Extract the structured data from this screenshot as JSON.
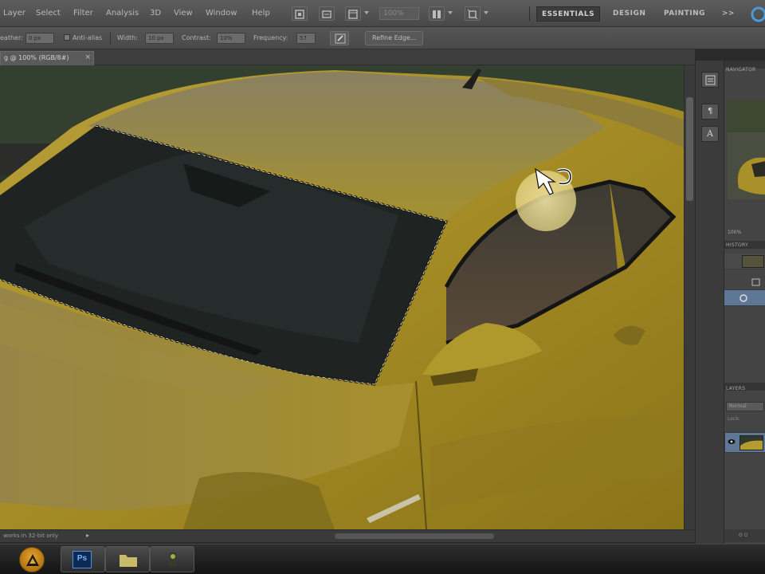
{
  "menu": {
    "items": [
      "Layer",
      "Select",
      "Filter",
      "Analysis",
      "3D",
      "View",
      "Window",
      "Help"
    ]
  },
  "app_bar": {
    "zoom": "100%",
    "workspaces": [
      "ESSENTIALS",
      "DESIGN",
      "PAINTING",
      ">>"
    ]
  },
  "options": {
    "feather_label": "eather:",
    "feather_value": "0 px",
    "anti_alias_label": "Anti-alias",
    "width_label": "Width:",
    "width_value": "10 px",
    "contrast_label": "Contrast:",
    "contrast_value": "10%",
    "frequency_label": "Frequency:",
    "frequency_value": "57",
    "refine_edge_label": "Refine Edge..."
  },
  "document": {
    "tab_title": "g @ 100% (RGB/8#)",
    "status_text": "works in 32-bit only"
  },
  "panels": {
    "navigator_title": "NAVIGATOR",
    "navigator_zoom": "100%",
    "history_title": "HISTORY",
    "layers_title": "LAYERS",
    "blend_mode": "Normal",
    "lock_label": "Lock:",
    "bottom_text": "Θ O"
  },
  "taskbar": {
    "ps_label": "Ps"
  },
  "colors": {
    "car_body": "#a8902a",
    "accent_blue": "#5f7796",
    "start_orb": "#e6a62c"
  }
}
